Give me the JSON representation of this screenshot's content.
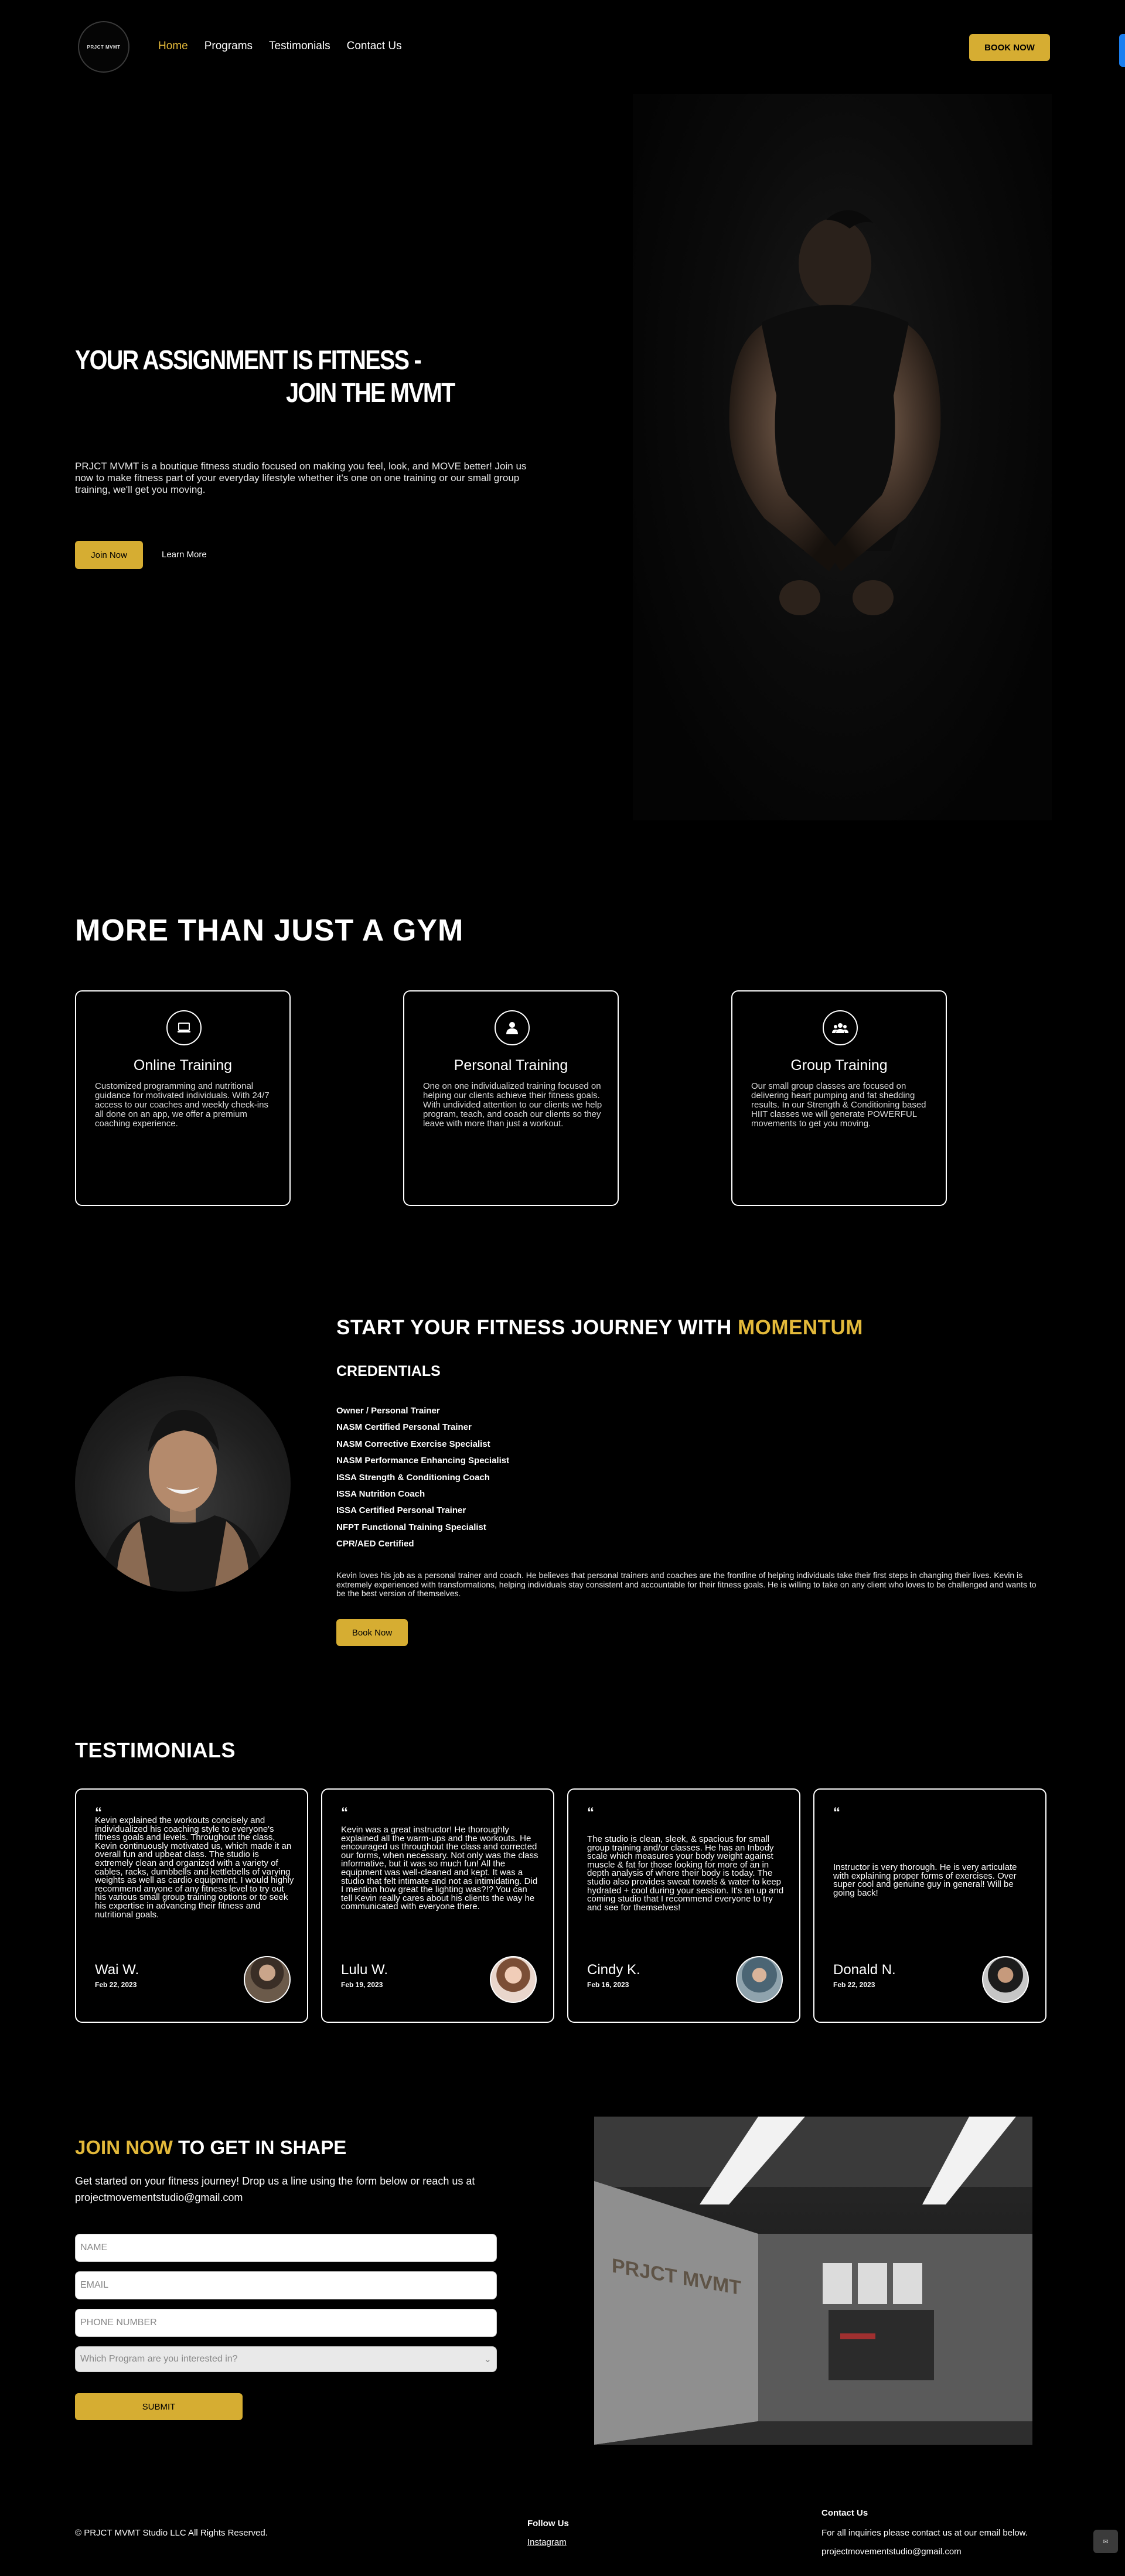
{
  "header": {
    "logo_text": "PRJCT MVMT",
    "nav": [
      {
        "label": "Home",
        "active": true
      },
      {
        "label": "Programs",
        "active": false
      },
      {
        "label": "Testimonials",
        "active": false
      },
      {
        "label": "Contact Us",
        "active": false
      }
    ],
    "book_now": "BOOK NOW"
  },
  "hero": {
    "title_line1": "YOUR ASSIGNMENT IS FITNESS -",
    "title_line2": "JOIN THE MVMT",
    "text": "PRJCT MVMT is a boutique fitness studio focused on making you feel, look, and MOVE better! Join us now to make fitness part of your everyday lifestyle whether it's one on one training or our small group training, we'll get you moving.",
    "join_now": "Join Now",
    "learn_more": "Learn More"
  },
  "gym": {
    "title": "MORE THAN JUST A GYM",
    "cards": [
      {
        "title": "Online Training",
        "icon": "laptop-icon",
        "text": "Customized programming and nutritional guidance for motivated individuals. With 24/7 access to our coaches and weekly check-ins all done on an app, we offer a premium coaching experience."
      },
      {
        "title": "Personal Training",
        "icon": "user-icon",
        "text": "One on one individualized training focused on helping our clients achieve their fitness goals. With undivided attention to our clients we help program, teach, and coach our clients so they leave with more than just a workout."
      },
      {
        "title": "Group Training",
        "icon": "group-icon",
        "text": "Our small group classes are focused on delivering heart pumping and fat shedding results. In our Strength & Conditioning based HIIT classes we will generate POWERFUL movements to get you moving."
      }
    ]
  },
  "journey": {
    "title_prefix": "START YOUR FITNESS JOURNEY WITH ",
    "title_highlight": "MOMENTUM",
    "credentials_title": "CREDENTIALS",
    "credentials": [
      "Owner / Personal Trainer",
      "NASM Certified Personal Trainer",
      "NASM Corrective Exercise Specialist",
      "NASM Performance Enhancing Specialist",
      "ISSA Strength & Conditioning Coach",
      "ISSA Nutrition Coach",
      "ISSA Certified Personal Trainer",
      "NFPT Functional Training Specialist",
      "CPR/AED Certified"
    ],
    "bio": "Kevin loves his job as a personal trainer and coach. He believes that personal trainers and coaches are the frontline of helping individuals take their first steps in changing their lives. Kevin is extremely experienced with transformations, helping individuals stay consistent and accountable for their fitness goals. He is willing to take on any client who loves to be challenged and wants to be the best version of themselves.",
    "book_now": "Book Now"
  },
  "testimonials": {
    "title": "TESTIMONIALS",
    "quote_mark": "“",
    "items": [
      {
        "text": "Kevin explained the workouts concisely and individualized his coaching style to everyone's fitness goals and levels. Throughout the class, Kevin continuously motivated us, which made it an overall fun and upbeat class. The studio is extremely clean and organized with a variety of cables, racks, dumbbells and kettlebells of varying weights as well as cardio equipment. I would highly recommend anyone of any fitness level to try out his various small group training options or to seek his expertise in advancing their fitness and nutritional goals.",
        "name": "Wai W.",
        "date": "Feb 22, 2023"
      },
      {
        "text": "Kevin was a great instructor! He thoroughly explained all the warm-ups and the workouts. He encouraged us throughout the class and corrected our forms, when necessary. Not only was the class informative, but it was so much fun! All the equipment was well-cleaned and kept. It was a studio that felt intimate and not as intimidating. Did I mention how great the lighting was?!? You can tell Kevin really cares about his clients the way he communicated with everyone there.",
        "name": "Lulu W.",
        "date": "Feb 19, 2023"
      },
      {
        "text": "The studio is clean, sleek, & spacious for small group training and/or classes. He has an Inbody scale which measures your body weight against muscle & fat for those looking for more of an in depth analysis of where their body is today. The studio also provides sweat towels & water to keep hydrated + cool during your session. It's an up and coming studio that I recommend everyone to try and see for themselves!",
        "name": "Cindy K.",
        "date": "Feb 16, 2023"
      },
      {
        "text": "Instructor is very thorough. He is very articulate with explaining proper forms of exercises. Over super cool and genuine guy in general! Will be going back!",
        "name": "Donald N.",
        "date": "Feb 22, 2023"
      }
    ]
  },
  "contact": {
    "title_highlight": "JOIN NOW",
    "title_rest": " TO GET IN SHAPE",
    "text": "Get started on your fitness journey! Drop us a line using the form below or reach us at projectmovementstudio@gmail.com",
    "name_placeholder": "NAME",
    "email_placeholder": "EMAIL",
    "phone_placeholder": "PHONE NUMBER",
    "program_select": "Which Program are you interested in?",
    "submit": "SUBMIT",
    "studio_sign": "PRJCT MVMT"
  },
  "footer": {
    "copyright": "© PRJCT MVMT Studio LLC All Rights Reserved.",
    "follow_title": "Follow Us",
    "instagram": "Instagram",
    "contact_title": "Contact Us",
    "contact_text": "For all inquiries please contact us at our email below.",
    "email": "projectmovementstudio@gmail.com",
    "chat_label": "✉"
  },
  "colors": {
    "accent": "#d6ad32",
    "background": "#000000",
    "text": "#ffffff"
  }
}
